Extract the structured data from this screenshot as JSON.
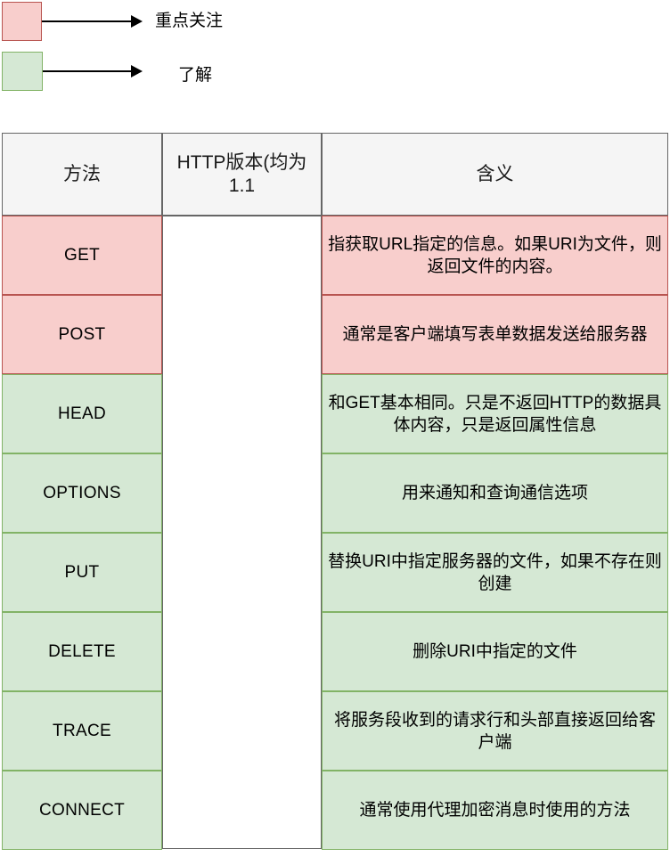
{
  "legend": {
    "items": [
      {
        "swatch_color": "#f8cecc",
        "swatch_border": "#b85450",
        "label": "重点关注",
        "arrow": "arrow-right"
      },
      {
        "swatch_color": "#d5e8d4",
        "swatch_border": "#82b366",
        "label": "了解",
        "arrow": "arrow-right"
      }
    ]
  },
  "table": {
    "headers": [
      "方法",
      "HTTP版本(均为1.1",
      "含义"
    ],
    "merged_version_cell": "",
    "rows": [
      {
        "method": "GET",
        "meaning": "指获取URL指定的信息。如果URI为文件，则返回文件的内容。",
        "highlight": "red"
      },
      {
        "method": "POST",
        "meaning": "通常是客户端填写表单数据发送给服务器",
        "highlight": "red"
      },
      {
        "method": "HEAD",
        "meaning": "和GET基本相同。只是不返回HTTP的数据具体内容，只是返回属性信息",
        "highlight": "green"
      },
      {
        "method": "OPTIONS",
        "meaning": "用来通知和查询通信选项",
        "highlight": "green"
      },
      {
        "method": "PUT",
        "meaning": "替换URI中指定服务器的文件，如果不存在则创建",
        "highlight": "green"
      },
      {
        "method": "DELETE",
        "meaning": "删除URI中指定的文件",
        "highlight": "green"
      },
      {
        "method": "TRACE",
        "meaning": "将服务段收到的请求行和头部直接返回给客户端",
        "highlight": "green"
      },
      {
        "method": "CONNECT",
        "meaning": "通常使用代理加密消息时使用的方法",
        "highlight": "green"
      }
    ]
  },
  "colors": {
    "red_fill": "#f8cecc",
    "red_border": "#b85450",
    "green_fill": "#d5e8d4",
    "green_border": "#82b366",
    "header_fill": "#f5f5f5",
    "header_border": "#666666",
    "white_fill": "#ffffff"
  }
}
